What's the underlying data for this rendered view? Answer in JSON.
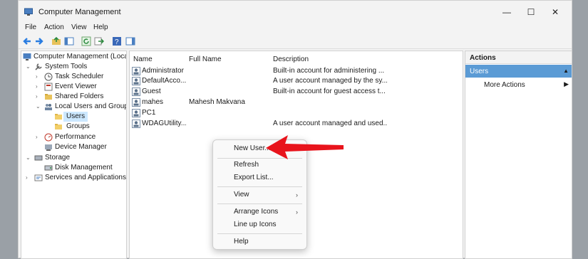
{
  "window": {
    "title": "Computer Management",
    "minimize": "—",
    "maximize": "☐",
    "close": "✕"
  },
  "menu": [
    "File",
    "Action",
    "View",
    "Help"
  ],
  "tree": [
    {
      "label": "Computer Management (Local)"
    },
    {
      "label": "System Tools"
    },
    {
      "label": "Task Scheduler"
    },
    {
      "label": "Event Viewer"
    },
    {
      "label": "Shared Folders"
    },
    {
      "label": "Local Users and Groups"
    },
    {
      "label": "Users"
    },
    {
      "label": "Groups"
    },
    {
      "label": "Performance"
    },
    {
      "label": "Device Manager"
    },
    {
      "label": "Storage"
    },
    {
      "label": "Disk Management"
    },
    {
      "label": "Services and Applications"
    }
  ],
  "list": {
    "columns": [
      "Name",
      "Full Name",
      "Description"
    ],
    "rows": [
      {
        "name": "Administrator",
        "full_name": "",
        "description": "Built-in account for administering ..."
      },
      {
        "name": "DefaultAcco...",
        "full_name": "",
        "description": "A user account managed by the sy..."
      },
      {
        "name": "Guest",
        "full_name": "",
        "description": "Built-in account for guest access t..."
      },
      {
        "name": "mahes",
        "full_name": "Mahesh Makvana",
        "description": ""
      },
      {
        "name": "PC1",
        "full_name": "",
        "description": ""
      },
      {
        "name": "WDAGUtility...",
        "full_name": "",
        "description": "A user account managed and used..."
      }
    ]
  },
  "actions": {
    "header": "Actions",
    "section": "Users",
    "more": "More Actions"
  },
  "context_menu": {
    "new_user": "New User...",
    "refresh": "Refresh",
    "export_list": "Export List...",
    "view": "View",
    "arrange_icons": "Arrange Icons",
    "line_up_icons": "Line up Icons",
    "help": "Help"
  },
  "colors": {
    "accent": "#5b9bd5",
    "selection": "#cce8ff",
    "pointer": "#e8141c"
  }
}
